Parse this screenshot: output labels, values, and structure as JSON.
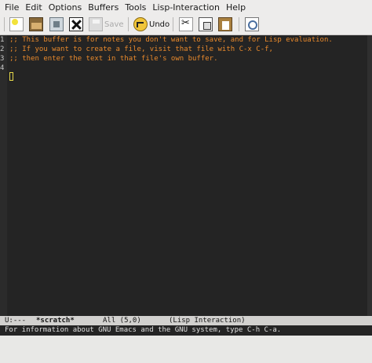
{
  "menubar": {
    "items": [
      "File",
      "Edit",
      "Options",
      "Buffers",
      "Tools",
      "Lisp-Interaction",
      "Help"
    ]
  },
  "toolbar": {
    "save_label": "Save",
    "undo_label": "Undo"
  },
  "editor": {
    "line_numbers": [
      "1",
      "2",
      "3",
      "4"
    ],
    "lines": [
      ";; This buffer is for notes you don't want to save, and for Lisp evaluation.",
      ";; If you want to create a file, visit that file with C-x C-f,",
      ";; then enter the text in that file's own buffer.",
      ""
    ]
  },
  "modeline": {
    "status": "U:---",
    "buffer_name": "*scratch*",
    "position": "All (5,0)",
    "mode": "(Lisp Interaction)"
  },
  "echo_area": {
    "message": "For information about GNU Emacs and the GNU system, type C-h C-a."
  },
  "colors": {
    "background": "#242424",
    "comment": "#e8892c",
    "cursor": "#e6d84a"
  }
}
